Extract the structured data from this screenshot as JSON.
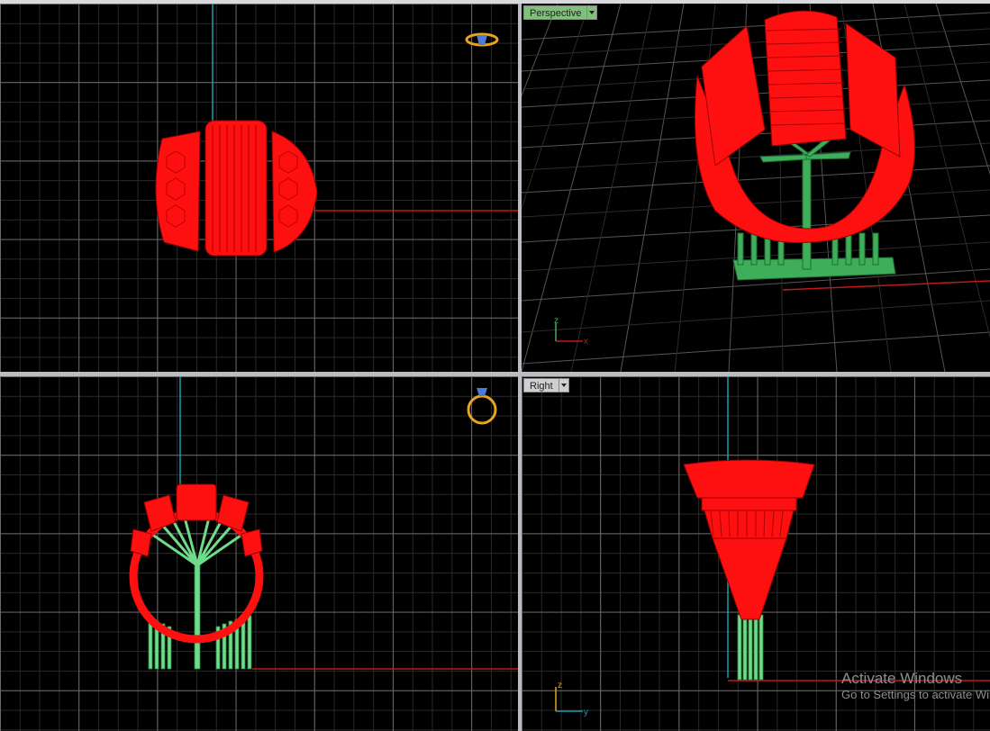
{
  "viewports": {
    "top": {
      "label": ""
    },
    "perspective": {
      "label": "Perspective"
    },
    "front": {
      "label": ""
    },
    "right": {
      "label": "Right"
    }
  },
  "axes": {
    "perspective": {
      "z": "z",
      "x": "x"
    },
    "right": {
      "z": "z",
      "y": "y"
    }
  },
  "colors": {
    "model": "#ff1010",
    "support": "#3fae5a",
    "axis_x": "#c01818",
    "axis_y": "#1a9fb0",
    "grid_major": "#6a6a6a",
    "grid_minor": "#2a2a2a",
    "active_label": "#7fc07a",
    "ring_icon": "#e7a321"
  },
  "watermark": {
    "title": "Activate Windows",
    "subtitle": "Go to Settings to activate Windows."
  }
}
